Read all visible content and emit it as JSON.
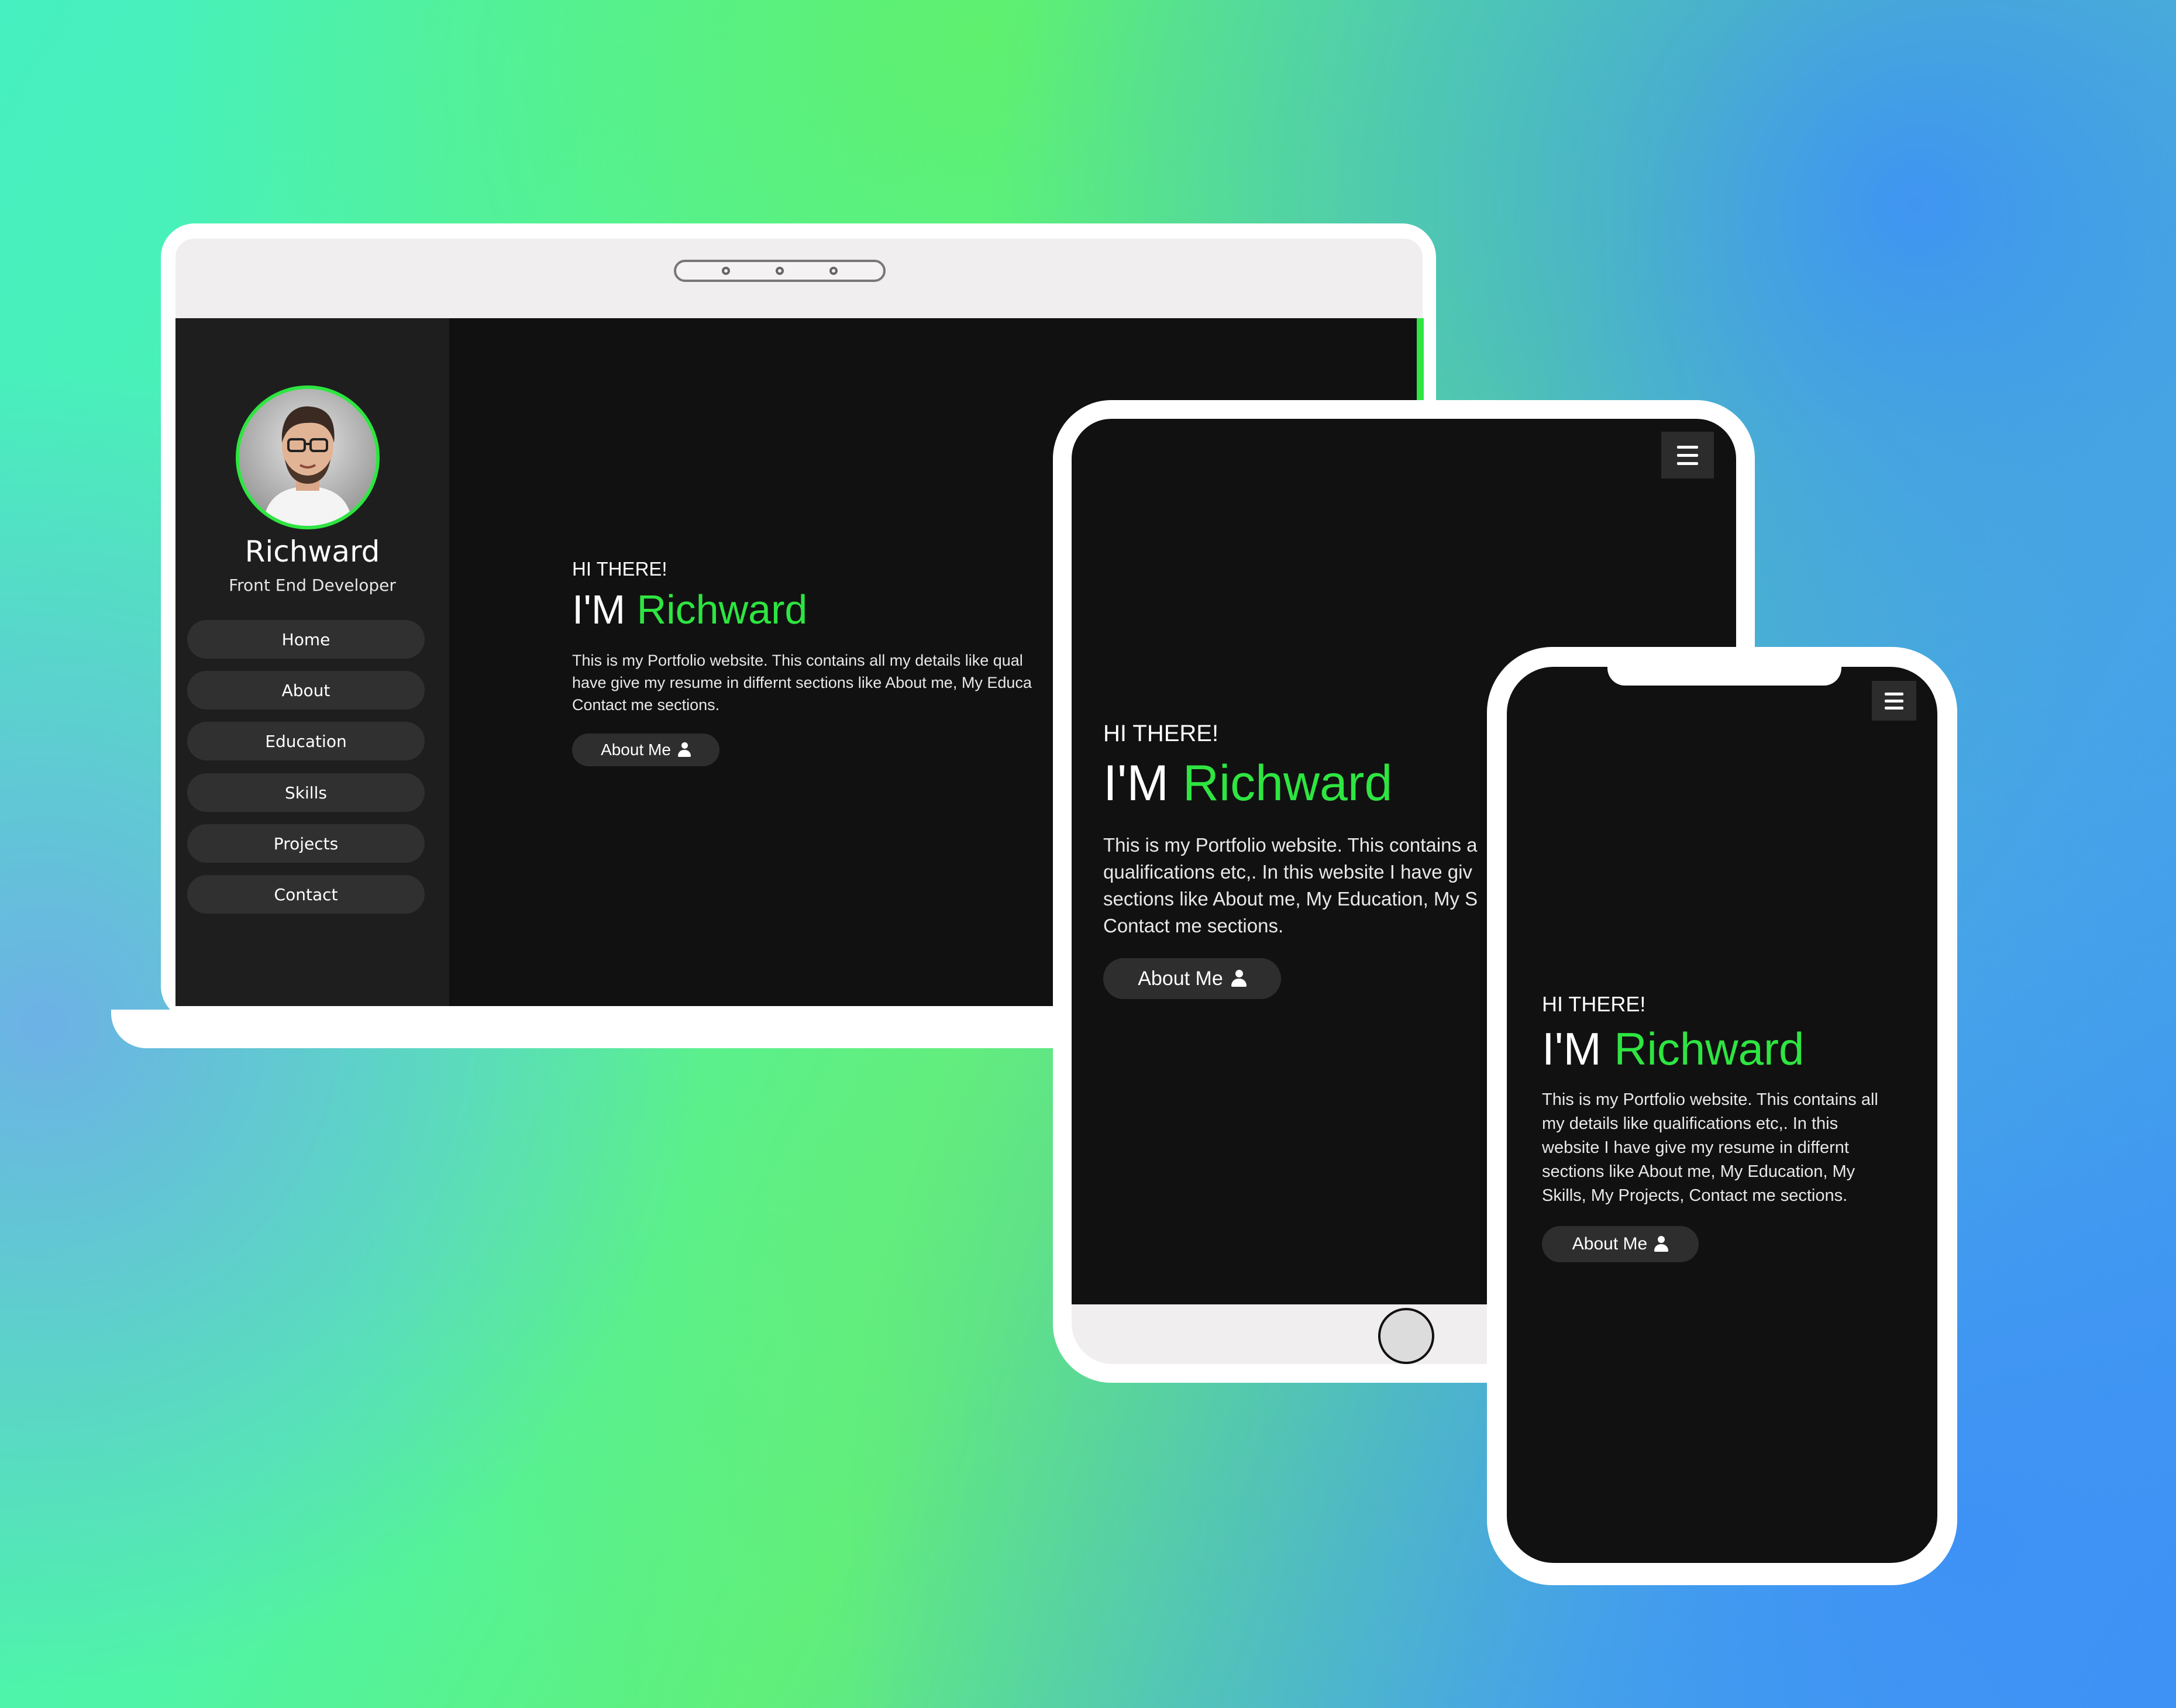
{
  "profile": {
    "name": "Richward",
    "role": "Front End Developer"
  },
  "nav": {
    "items": [
      "Home",
      "About",
      "Education",
      "Skills",
      "Projects",
      "Contact"
    ]
  },
  "laptop": {
    "greeting": "HI THERE!",
    "title_prefix": "I'M ",
    "title_name": "Richward",
    "desc_lines": [
      "This is my Portfolio website. This contains all my details like qual",
      "have give my resume in differnt sections like About me, My Educa",
      "Contact me sections."
    ],
    "button_label": "About Me"
  },
  "tablet": {
    "greeting": "HI THERE!",
    "title_prefix": "I'M ",
    "title_name": "Richward",
    "desc_lines": [
      "This is my Portfolio website. This contains a",
      "qualifications etc,. In this website I have giv",
      "sections like About me, My Education, My S",
      "Contact me sections."
    ],
    "button_label": "About Me"
  },
  "phone": {
    "greeting": "HI THERE!",
    "title_prefix": "I'M ",
    "title_name": "Richward",
    "desc_lines": [
      "This is my Portfolio website. This contains all",
      "my details like qualifications etc,. In this",
      "website I have give my resume in differnt",
      "sections like About me, My Education, My",
      "Skills, My Projects, Contact me sections."
    ],
    "button_label": "About Me"
  },
  "colors": {
    "accent": "#2ee541",
    "screen_bg": "#111111",
    "sidebar_bg": "#1e1e1e",
    "button_bg": "#2e2e2e"
  },
  "icons": [
    "user-icon",
    "hamburger-menu-icon",
    "avatar-photo"
  ]
}
